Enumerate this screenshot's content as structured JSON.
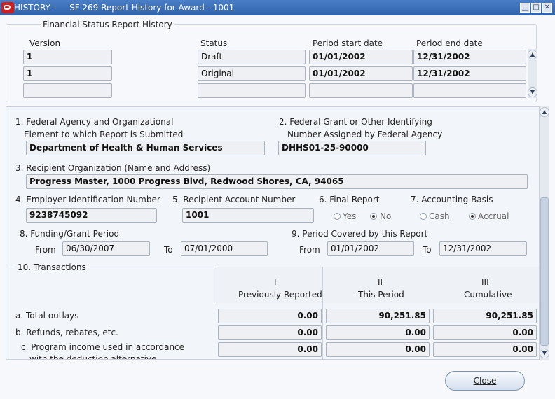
{
  "window": {
    "title": "HISTORY -     SF 269 Report History for Award - 1001",
    "min": "▁",
    "max": "□",
    "close": "✕"
  },
  "history": {
    "group_label": "Financial Status Report History",
    "headers": {
      "version": "Version",
      "status": "Status",
      "start": "Period start date",
      "end": "Period end date"
    },
    "rows": [
      {
        "version": "1",
        "status": "Draft",
        "start": "01/01/2002",
        "end": "12/31/2002"
      },
      {
        "version": "1",
        "status": "Original",
        "start": "01/01/2002",
        "end": "12/31/2002"
      },
      {
        "version": "",
        "status": "",
        "start": "",
        "end": ""
      }
    ]
  },
  "form": {
    "f1_label_a": "1. Federal Agency and Organizational",
    "f1_label_b": "Element to which Report is Submitted",
    "f1_value": "Department of Health & Human Services",
    "f2_label_a": "2. Federal Grant or Other Identifying",
    "f2_label_b": "Number Assigned by Federal Agency",
    "f2_value": "DHHS01-25-90000",
    "f3_label": "3. Recipient Organization (Name and Address)",
    "f3_value": "Progress Master, 1000 Progress Blvd, Redwood Shores, CA, 94065",
    "f4_label": "4. Employer Identification Number",
    "f4_value": "9238745092",
    "f5_label": "5. Recipient Account Number",
    "f5_value": "1001",
    "f6_label": "6. Final Report",
    "f6_yes": "Yes",
    "f6_no": "No",
    "f7_label": "7. Accounting Basis",
    "f7_cash": "Cash",
    "f7_accrual": "Accrual",
    "f8_label": "8. Funding/Grant Period",
    "f8_from_label": "From",
    "f8_from": "06/30/2007",
    "f8_to_label": "To",
    "f8_to": "07/01/2000",
    "f9_label": "9. Period Covered by this Report",
    "f9_from_label": "From",
    "f9_from": "01/01/2002",
    "f9_to_label": "To",
    "f9_to": "12/31/2002"
  },
  "transactions": {
    "label": "10. Transactions",
    "col1_num": "I",
    "col1_name": "Previously Reported",
    "col2_num": "II",
    "col2_name": "This Period",
    "col3_num": "III",
    "col3_name": "Cumulative",
    "row_a": "a. Total outlays",
    "row_b": "b. Refunds, rebates, etc.",
    "row_c1": "c. Program income used in accordance",
    "row_c2": "with the deduction alternative",
    "a": [
      "0.00",
      "90,251.85",
      "90,251.85"
    ],
    "b": [
      "0.00",
      "0.00",
      "0.00"
    ],
    "c": [
      "0.00",
      "0.00",
      "0.00"
    ]
  },
  "close_label": "Close"
}
